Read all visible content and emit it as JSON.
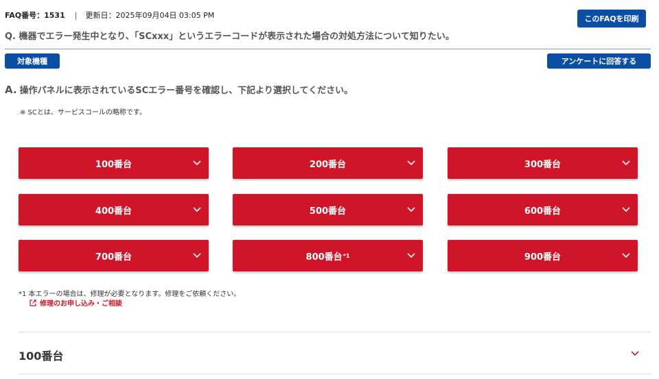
{
  "header": {
    "faq_number": "FAQ番号：1531",
    "separator": "|",
    "updated": "更新日：2025年09月04日 03:05 PM",
    "print_label": "このFAQを印刷"
  },
  "question": "Q. 機器でエラー発生中となり、「SCxxx」というエラーコードが表示された場合の対処方法について知りたい。",
  "device_label": "対象機種",
  "survey_label": "アンケートに回答する",
  "answer": {
    "prefix": "A.",
    "text": "操作パネルに表示されているSCエラー番号を確認し、下記より選択してください。"
  },
  "note": "※ SCとは、サービスコールの略称です。",
  "sc_buttons": [
    {
      "label": "100番台",
      "sup": ""
    },
    {
      "label": "200番台",
      "sup": ""
    },
    {
      "label": "300番台",
      "sup": ""
    },
    {
      "label": "400番台",
      "sup": ""
    },
    {
      "label": "500番台",
      "sup": ""
    },
    {
      "label": "600番台",
      "sup": ""
    },
    {
      "label": "700番台",
      "sup": ""
    },
    {
      "label": "800番台",
      "sup": "*1"
    },
    {
      "label": "900番台",
      "sup": ""
    }
  ],
  "footnote": "*1 本エラーの場合は、修理が必要となります。修理をご依頼ください。",
  "repair_link": "修理のお申し込み・ご相談",
  "accordion": {
    "title": "100番台"
  },
  "colors": {
    "brand_blue": "#0b4ea2",
    "brand_red": "#cf1529"
  },
  "icons": {
    "button_chevron": "chevron-down-icon",
    "external_link": "external-link-icon"
  }
}
